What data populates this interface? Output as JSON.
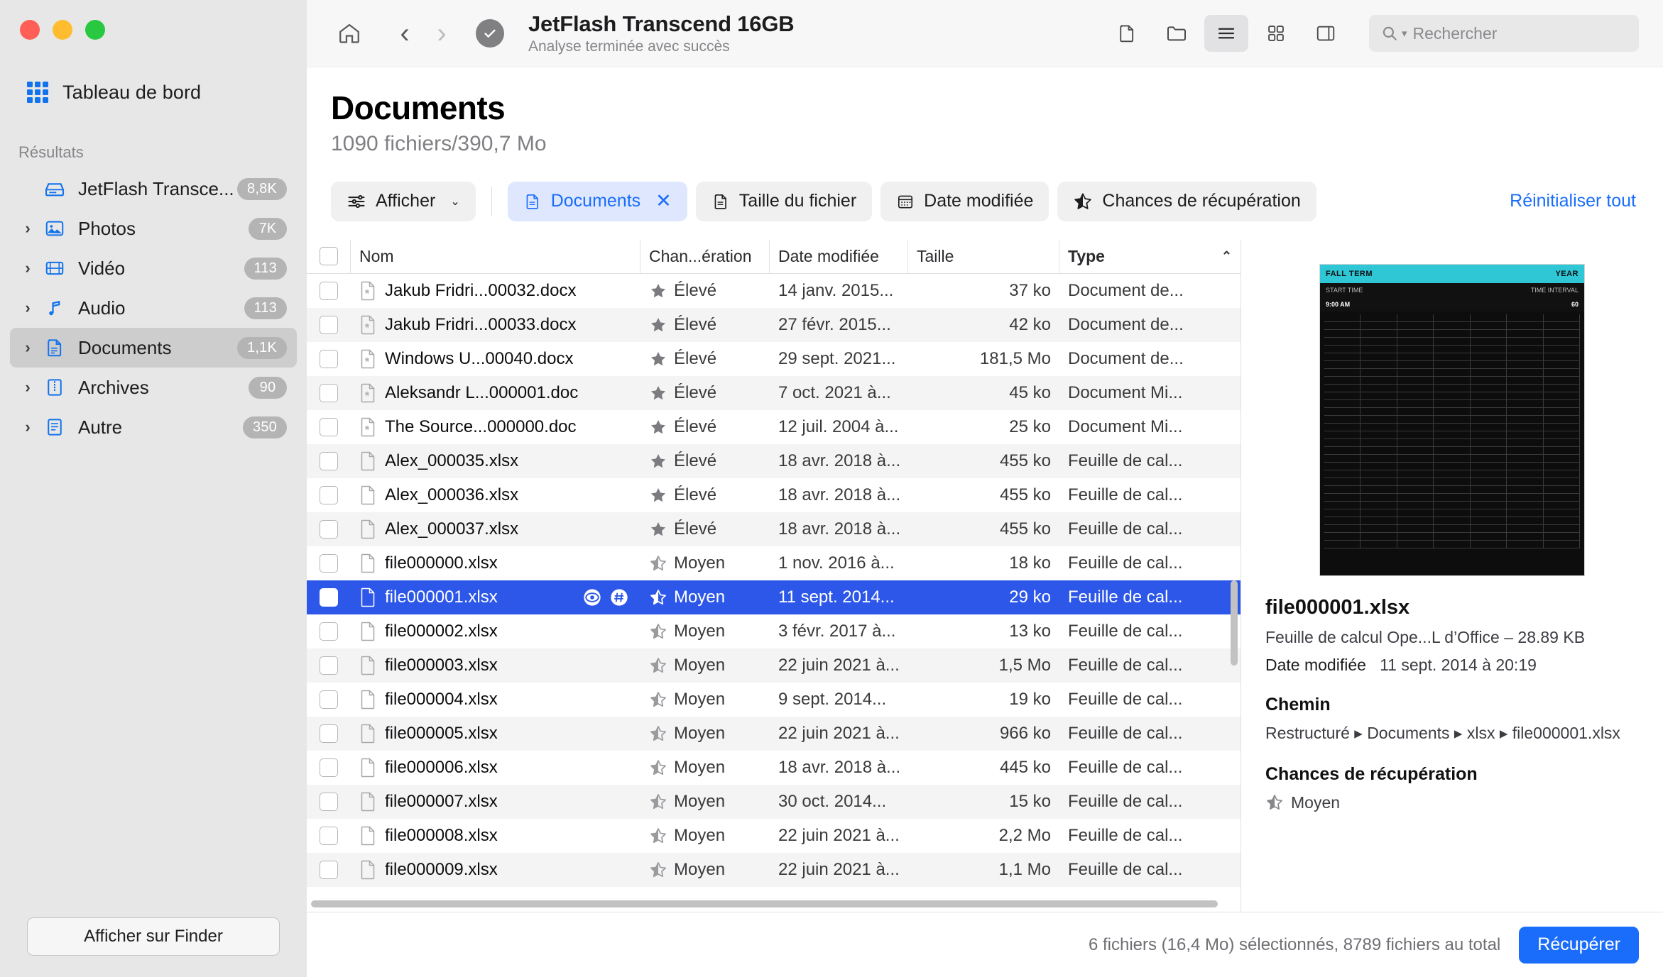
{
  "window": {
    "traffic_lights": [
      "close",
      "minimize",
      "zoom"
    ]
  },
  "sidebar": {
    "dashboard_label": "Tableau de bord",
    "section_label": "Résultats",
    "items": [
      {
        "label": "JetFlash Transce...",
        "badge": "8,8K",
        "icon": "drive-icon",
        "expandable": false,
        "selected": false
      },
      {
        "label": "Photos",
        "badge": "7K",
        "icon": "photos-icon",
        "expandable": true,
        "selected": false
      },
      {
        "label": "Vidéo",
        "badge": "113",
        "icon": "video-icon",
        "expandable": true,
        "selected": false
      },
      {
        "label": "Audio",
        "badge": "113",
        "icon": "audio-icon",
        "expandable": true,
        "selected": false
      },
      {
        "label": "Documents",
        "badge": "1,1K",
        "icon": "document-icon",
        "expandable": true,
        "selected": true
      },
      {
        "label": "Archives",
        "badge": "90",
        "icon": "archive-icon",
        "expandable": true,
        "selected": false
      },
      {
        "label": "Autre",
        "badge": "350",
        "icon": "other-icon",
        "expandable": true,
        "selected": false
      }
    ],
    "finder_button": "Afficher sur Finder"
  },
  "toolbar": {
    "home_icon": "home-icon",
    "back_icon": "chevron-left-icon",
    "forward_icon": "chevron-right-icon",
    "status_icon": "check-circle-icon",
    "title": "JetFlash Transcend 16GB",
    "subtitle": "Analyse terminée avec succès",
    "view_buttons": [
      {
        "name": "preview-view-button",
        "icon": "document-view-icon",
        "active": false
      },
      {
        "name": "folder-view-button",
        "icon": "folder-view-icon",
        "active": false
      },
      {
        "name": "list-view-button",
        "icon": "list-view-icon",
        "active": true
      },
      {
        "name": "grid-view-button",
        "icon": "grid-view-icon",
        "active": false
      },
      {
        "name": "sidebar-toggle-button",
        "icon": "panel-right-icon",
        "active": false
      }
    ],
    "search_placeholder": "Rechercher",
    "search_value": ""
  },
  "page": {
    "title": "Documents",
    "subtitle": "1090 fichiers/390,7 Mo"
  },
  "filters": {
    "display_label": "Afficher",
    "display_icon": "sliders-icon",
    "chips": [
      {
        "label": "Documents",
        "icon": "document-icon",
        "active": true,
        "removable": true
      },
      {
        "label": "Taille du fichier",
        "icon": "document-outline-icon",
        "active": false,
        "removable": false
      },
      {
        "label": "Date modifiée",
        "icon": "calendar-icon",
        "active": false,
        "removable": false
      },
      {
        "label": "Chances de récupération",
        "icon": "star-half-icon",
        "active": false,
        "removable": false
      }
    ],
    "reset_label": "Réinitialiser tout"
  },
  "table": {
    "columns": [
      "Nom",
      "Chan...ération",
      "Date modifiée",
      "Taille",
      "Type"
    ],
    "sort_column": "Type",
    "sort_direction": "asc",
    "sort_caret": "⌃",
    "rows": [
      {
        "name": "Jakub Fridri...00032.docx",
        "chance": "Élevé",
        "star": "full",
        "date": "14 janv. 2015...",
        "size": "37 ko",
        "type": "Document de...",
        "icon": "docx-icon",
        "selected": false,
        "checked": false
      },
      {
        "name": "Jakub Fridri...00033.docx",
        "chance": "Élevé",
        "star": "full",
        "date": "27 févr. 2015...",
        "size": "42 ko",
        "type": "Document de...",
        "icon": "docx-icon",
        "selected": false,
        "checked": false
      },
      {
        "name": "Windows U...00040.docx",
        "chance": "Élevé",
        "star": "full",
        "date": "29 sept. 2021...",
        "size": "181,5 Mo",
        "type": "Document de...",
        "icon": "docx-icon",
        "selected": false,
        "checked": false
      },
      {
        "name": "Aleksandr L...000001.doc",
        "chance": "Élevé",
        "star": "full",
        "date": "7 oct. 2021 à...",
        "size": "45 ko",
        "type": "Document Mi...",
        "icon": "docx-icon",
        "selected": false,
        "checked": false
      },
      {
        "name": "The Source...000000.doc",
        "chance": "Élevé",
        "star": "full",
        "date": "12 juil. 2004 à...",
        "size": "25 ko",
        "type": "Document Mi...",
        "icon": "docx-icon",
        "selected": false,
        "checked": false
      },
      {
        "name": "Alex_000035.xlsx",
        "chance": "Élevé",
        "star": "full",
        "date": "18 avr. 2018 à...",
        "size": "455 ko",
        "type": "Feuille de cal...",
        "icon": "file-icon",
        "selected": false,
        "checked": false
      },
      {
        "name": "Alex_000036.xlsx",
        "chance": "Élevé",
        "star": "full",
        "date": "18 avr. 2018 à...",
        "size": "455 ko",
        "type": "Feuille de cal...",
        "icon": "file-icon",
        "selected": false,
        "checked": false
      },
      {
        "name": "Alex_000037.xlsx",
        "chance": "Élevé",
        "star": "full",
        "date": "18 avr. 2018 à...",
        "size": "455 ko",
        "type": "Feuille de cal...",
        "icon": "file-icon",
        "selected": false,
        "checked": false
      },
      {
        "name": "file000000.xlsx",
        "chance": "Moyen",
        "star": "half",
        "date": "1 nov. 2016 à...",
        "size": "18 ko",
        "type": "Feuille de cal...",
        "icon": "file-icon",
        "selected": false,
        "checked": false
      },
      {
        "name": "file000001.xlsx",
        "chance": "Moyen",
        "star": "half",
        "date": "11 sept. 2014...",
        "size": "29 ko",
        "type": "Feuille de cal...",
        "icon": "file-icon",
        "selected": true,
        "checked": true
      },
      {
        "name": "file000002.xlsx",
        "chance": "Moyen",
        "star": "half",
        "date": "3 févr. 2017 à...",
        "size": "13 ko",
        "type": "Feuille de cal...",
        "icon": "file-icon",
        "selected": false,
        "checked": false
      },
      {
        "name": "file000003.xlsx",
        "chance": "Moyen",
        "star": "half",
        "date": "22 juin 2021 à...",
        "size": "1,5 Mo",
        "type": "Feuille de cal...",
        "icon": "file-icon",
        "selected": false,
        "checked": false
      },
      {
        "name": "file000004.xlsx",
        "chance": "Moyen",
        "star": "half",
        "date": "9 sept. 2014...",
        "size": "19 ko",
        "type": "Feuille de cal...",
        "icon": "file-icon",
        "selected": false,
        "checked": false
      },
      {
        "name": "file000005.xlsx",
        "chance": "Moyen",
        "star": "half",
        "date": "22 juin 2021 à...",
        "size": "966 ko",
        "type": "Feuille de cal...",
        "icon": "file-icon",
        "selected": false,
        "checked": false
      },
      {
        "name": "file000006.xlsx",
        "chance": "Moyen",
        "star": "half",
        "date": "18 avr. 2018 à...",
        "size": "445 ko",
        "type": "Feuille de cal...",
        "icon": "file-icon",
        "selected": false,
        "checked": false
      },
      {
        "name": "file000007.xlsx",
        "chance": "Moyen",
        "star": "half",
        "date": "30 oct. 2014...",
        "size": "15 ko",
        "type": "Feuille de cal...",
        "icon": "file-icon",
        "selected": false,
        "checked": false
      },
      {
        "name": "file000008.xlsx",
        "chance": "Moyen",
        "star": "half",
        "date": "22 juin 2021 à...",
        "size": "2,2 Mo",
        "type": "Feuille de cal...",
        "icon": "file-icon",
        "selected": false,
        "checked": false
      },
      {
        "name": "file000009.xlsx",
        "chance": "Moyen",
        "star": "half",
        "date": "22 juin 2021 à...",
        "size": "1,1 Mo",
        "type": "Feuille de cal...",
        "icon": "file-icon",
        "selected": false,
        "checked": false
      }
    ],
    "row_action_icons": [
      "eye-icon",
      "hash-icon"
    ]
  },
  "preview": {
    "thumbnail": {
      "header_title": "FALL TERM",
      "year_label": "YEAR",
      "start_time_label": "START TIME",
      "start_time_value": "9:00 AM",
      "interval_label": "TIME INTERVAL",
      "interval_value": "60"
    },
    "file_name": "file000001.xlsx",
    "type_line": "Feuille de calcul Ope...L d’Office – 28.89 KB",
    "date_label": "Date modifiée",
    "date_value": "11 sept. 2014 à 20:19",
    "path_heading": "Chemin",
    "path_value": "Restructuré ▸ Documents ▸ xlsx ▸ file000001.xlsx",
    "chance_heading": "Chances de récupération",
    "chance_value": "Moyen"
  },
  "bottom": {
    "status": "6 fichiers (16,4 Mo) sélectionnés, 8789 fichiers au total",
    "recover_label": "Récupérer"
  }
}
